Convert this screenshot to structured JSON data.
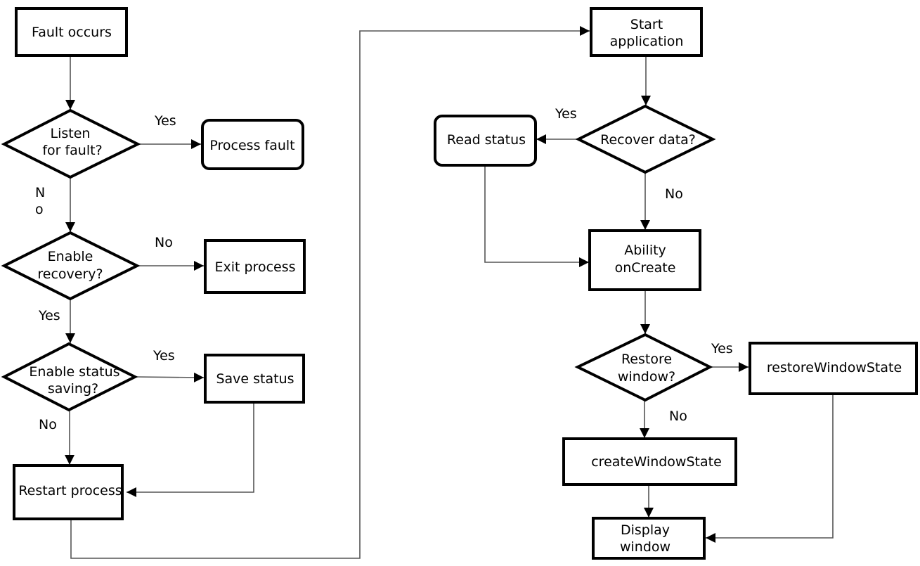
{
  "diagram": {
    "type": "flowchart",
    "nodes": {
      "fault_occurs": {
        "shape": "rect",
        "lines": [
          "Fault occurs"
        ]
      },
      "listen_for_fault": {
        "shape": "diamond",
        "lines": [
          "Listen",
          "for fault?"
        ]
      },
      "process_fault": {
        "shape": "rounded-rect",
        "lines": [
          "Process fault"
        ]
      },
      "enable_recovery": {
        "shape": "diamond",
        "lines": [
          "Enable",
          "recovery?"
        ]
      },
      "exit_process": {
        "shape": "rect",
        "lines": [
          "Exit process"
        ]
      },
      "enable_status_saving": {
        "shape": "diamond",
        "lines": [
          "Enable status",
          "saving?"
        ]
      },
      "save_status": {
        "shape": "rect",
        "lines": [
          "Save status"
        ]
      },
      "restart_process": {
        "shape": "rect",
        "lines": [
          "Restart process"
        ]
      },
      "start_application": {
        "shape": "rect",
        "lines": [
          "Start",
          "application"
        ]
      },
      "recover_data": {
        "shape": "diamond",
        "lines": [
          "Recover data?"
        ]
      },
      "read_status": {
        "shape": "rounded-rect",
        "lines": [
          "Read status"
        ]
      },
      "ability_oncreate": {
        "shape": "rect",
        "lines": [
          "Ability",
          "onCreate"
        ]
      },
      "restore_window": {
        "shape": "diamond",
        "lines": [
          "Restore",
          "window?"
        ]
      },
      "restore_window_state": {
        "shape": "rect",
        "lines": [
          "restoreWindowState"
        ]
      },
      "create_window_state": {
        "shape": "rect",
        "lines": [
          "createWindowState"
        ]
      },
      "display_window": {
        "shape": "rect",
        "lines": [
          "Display",
          "window"
        ]
      }
    },
    "edges": [
      {
        "from": "fault_occurs",
        "to": "listen_for_fault",
        "label": ""
      },
      {
        "from": "listen_for_fault",
        "to": "process_fault",
        "label": "Yes"
      },
      {
        "from": "listen_for_fault",
        "to": "enable_recovery",
        "label": "N\no"
      },
      {
        "from": "enable_recovery",
        "to": "exit_process",
        "label": "No"
      },
      {
        "from": "enable_recovery",
        "to": "enable_status_saving",
        "label": "Yes"
      },
      {
        "from": "enable_status_saving",
        "to": "save_status",
        "label": "Yes"
      },
      {
        "from": "enable_status_saving",
        "to": "restart_process",
        "label": "No"
      },
      {
        "from": "save_status",
        "to": "restart_process",
        "label": ""
      },
      {
        "from": "restart_process",
        "to": "start_application",
        "label": ""
      },
      {
        "from": "start_application",
        "to": "recover_data",
        "label": ""
      },
      {
        "from": "recover_data",
        "to": "read_status",
        "label": "Yes"
      },
      {
        "from": "recover_data",
        "to": "ability_oncreate",
        "label": "No"
      },
      {
        "from": "read_status",
        "to": "ability_oncreate",
        "label": ""
      },
      {
        "from": "ability_oncreate",
        "to": "restore_window",
        "label": ""
      },
      {
        "from": "restore_window",
        "to": "restore_window_state",
        "label": "Yes"
      },
      {
        "from": "restore_window",
        "to": "create_window_state",
        "label": "No"
      },
      {
        "from": "create_window_state",
        "to": "display_window",
        "label": ""
      },
      {
        "from": "restore_window_state",
        "to": "display_window",
        "label": ""
      }
    ],
    "edge_labels": {
      "listen_yes": "Yes",
      "listen_no_line1": "N",
      "listen_no_line2": "o",
      "recovery_no": "No",
      "recovery_yes": "Yes",
      "saving_yes": "Yes",
      "saving_no": "No",
      "recover_yes": "Yes",
      "recover_no": "No",
      "restore_yes": "Yes",
      "restore_no": "No"
    }
  }
}
